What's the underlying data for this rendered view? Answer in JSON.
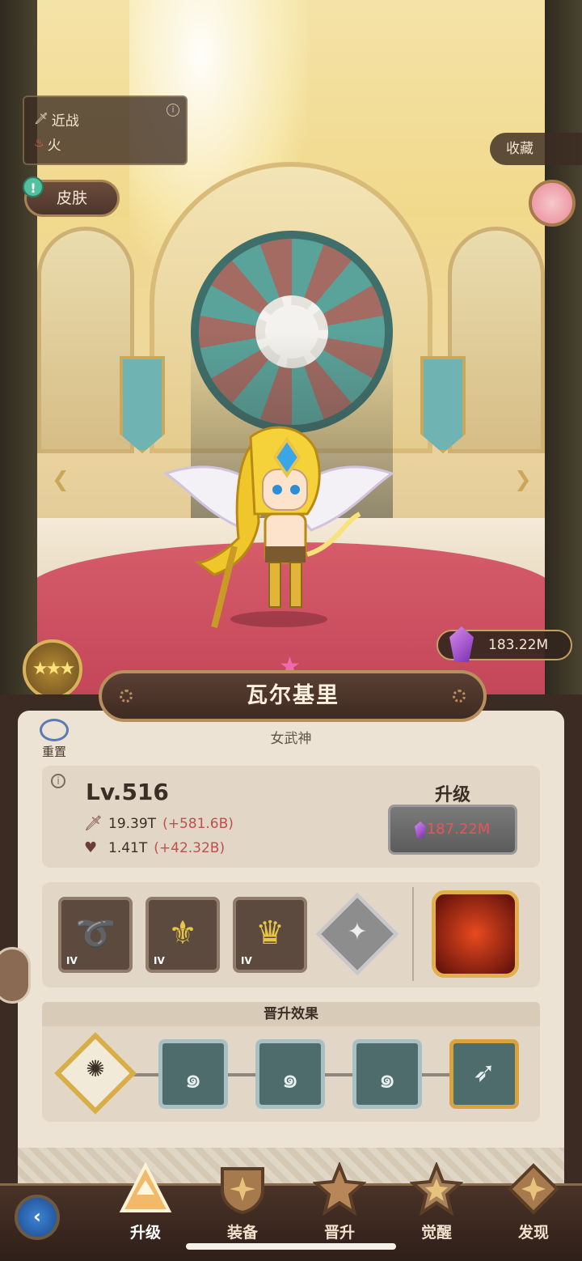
{
  "hero": {
    "attack_type": "近战",
    "element": "火",
    "skin_label": "皮肤",
    "favorite_label": "收藏",
    "name": "瓦尔基里",
    "class_title": "女武神",
    "crystal_balance": "183.22M",
    "star_count": 3
  },
  "panel": {
    "reset_label": "重置",
    "level": "Lv.516",
    "attack": "19.39T",
    "attack_bonus": "(+581.6B)",
    "hp": "1.41T",
    "hp_bonus": "(+42.32B)",
    "upgrade_title": "升级",
    "upgrade_cost": "187.22M",
    "equipment": [
      {
        "name": "golden-whip",
        "tier": "IV"
      },
      {
        "name": "winged-armor",
        "tier": "IV"
      },
      {
        "name": "tiara",
        "tier": "IV"
      }
    ],
    "advance_title": "晋升效果"
  },
  "nav": {
    "tabs": [
      {
        "label": "升级",
        "icon": "upgrade-icon",
        "active": true
      },
      {
        "label": "装备",
        "icon": "shield-icon",
        "active": false
      },
      {
        "label": "晋升",
        "icon": "promote-star-icon",
        "active": false
      },
      {
        "label": "觉醒",
        "icon": "awaken-star-icon",
        "active": false
      },
      {
        "label": "发现",
        "icon": "discover-icon",
        "active": false
      }
    ]
  },
  "colors": {
    "accent_gold": "#d9ae49",
    "cost_red": "#e5565a",
    "bonus_red": "#c0504f",
    "wood": "#3b2b22",
    "crystal_purple": "#7a2fae"
  }
}
